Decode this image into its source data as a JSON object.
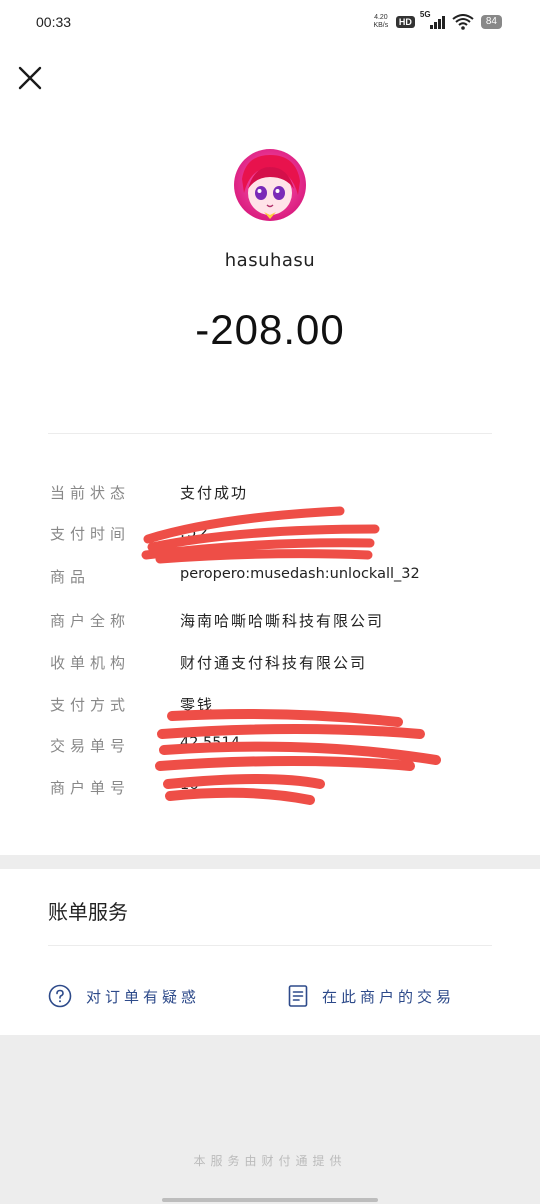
{
  "status_bar": {
    "time": "00:33",
    "net_speed": "4.20",
    "net_unit": "KB/s",
    "hd": "HD",
    "network": "5G",
    "battery": "84"
  },
  "header": {
    "close_icon": "close-icon"
  },
  "merchant": {
    "name": "hasuhasu"
  },
  "payment": {
    "amount": "-208.00"
  },
  "details": [
    {
      "label": "当前状态",
      "value": "支付成功"
    },
    {
      "label": "支付时间",
      "value": "                    :52"
    },
    {
      "label": "商品",
      "value": "peropero:musedash:unlockall_32"
    },
    {
      "label": "商户全称",
      "value": "海南哈嘶哈嘶科技有限公司"
    },
    {
      "label": "收单机构",
      "value": "财付通支付科技有限公司"
    },
    {
      "label": "支付方式",
      "value": "零钱"
    },
    {
      "label": "交易单号",
      "value": "42                                5514"
    },
    {
      "label": "商户单号",
      "value": "16"
    }
  ],
  "services": {
    "title": "账单服务",
    "links": [
      {
        "label": "对订单有疑惑",
        "icon": "question-circle-icon"
      },
      {
        "label": "在此商户的交易",
        "icon": "document-list-icon"
      }
    ]
  },
  "footer": {
    "note": "本服务由财付通提供"
  },
  "colors": {
    "link": "#2d4a8a",
    "redaction": "#ee4e47"
  }
}
